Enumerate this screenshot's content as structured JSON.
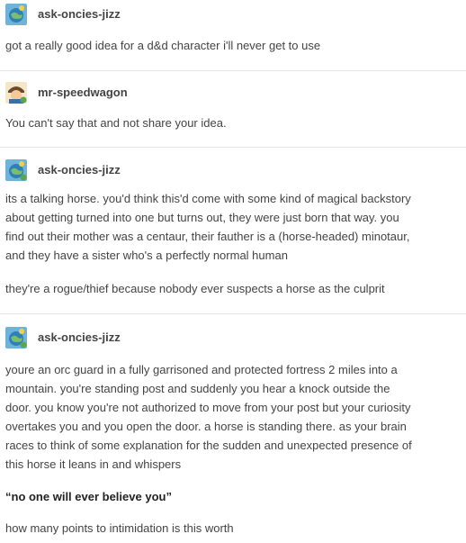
{
  "posts": [
    {
      "username": "ask-oncies-jizz",
      "avatar_icon": "blue-globe-avatar-icon",
      "paragraphs": [
        "got a really good idea for a d&d character i'll never get to use"
      ]
    },
    {
      "username": "mr-speedwagon",
      "avatar_icon": "cartoon-character-avatar-icon",
      "paragraphs": [
        "You can't say that and not share your idea."
      ]
    },
    {
      "username": "ask-oncies-jizz",
      "avatar_icon": "blue-globe-avatar-icon",
      "paragraphs": [
        "its a talking horse. you'd think this'd come with some kind of magical backstory",
        "about getting turned into one but turns out, they were just born that way. you",
        "find out their mother was a centaur, their fauther is a (horse-headed) minotaur,",
        "and they have a sister who's a perfectly normal human",
        "they're a rogue/thief because nobody ever suspects a horse as the culprit"
      ]
    },
    {
      "username": "ask-oncies-jizz",
      "avatar_icon": "blue-globe-avatar-icon",
      "paragraphs": [
        "youre an orc guard in a fully garrisoned and protected fortress 2 miles into a",
        "mountain. you're standing post and suddenly you hear a knock outside the",
        "door. you know you're not authorized to move from your post but your curiosity",
        "overtakes you and you open the door. a horse is standing there. as your brain",
        "races to think of some explanation for the sudden and unexpected presence of",
        "this horse it leans in and whispers",
        "“no one will ever believe you”",
        "how many points to intimidation is this worth"
      ]
    }
  ]
}
